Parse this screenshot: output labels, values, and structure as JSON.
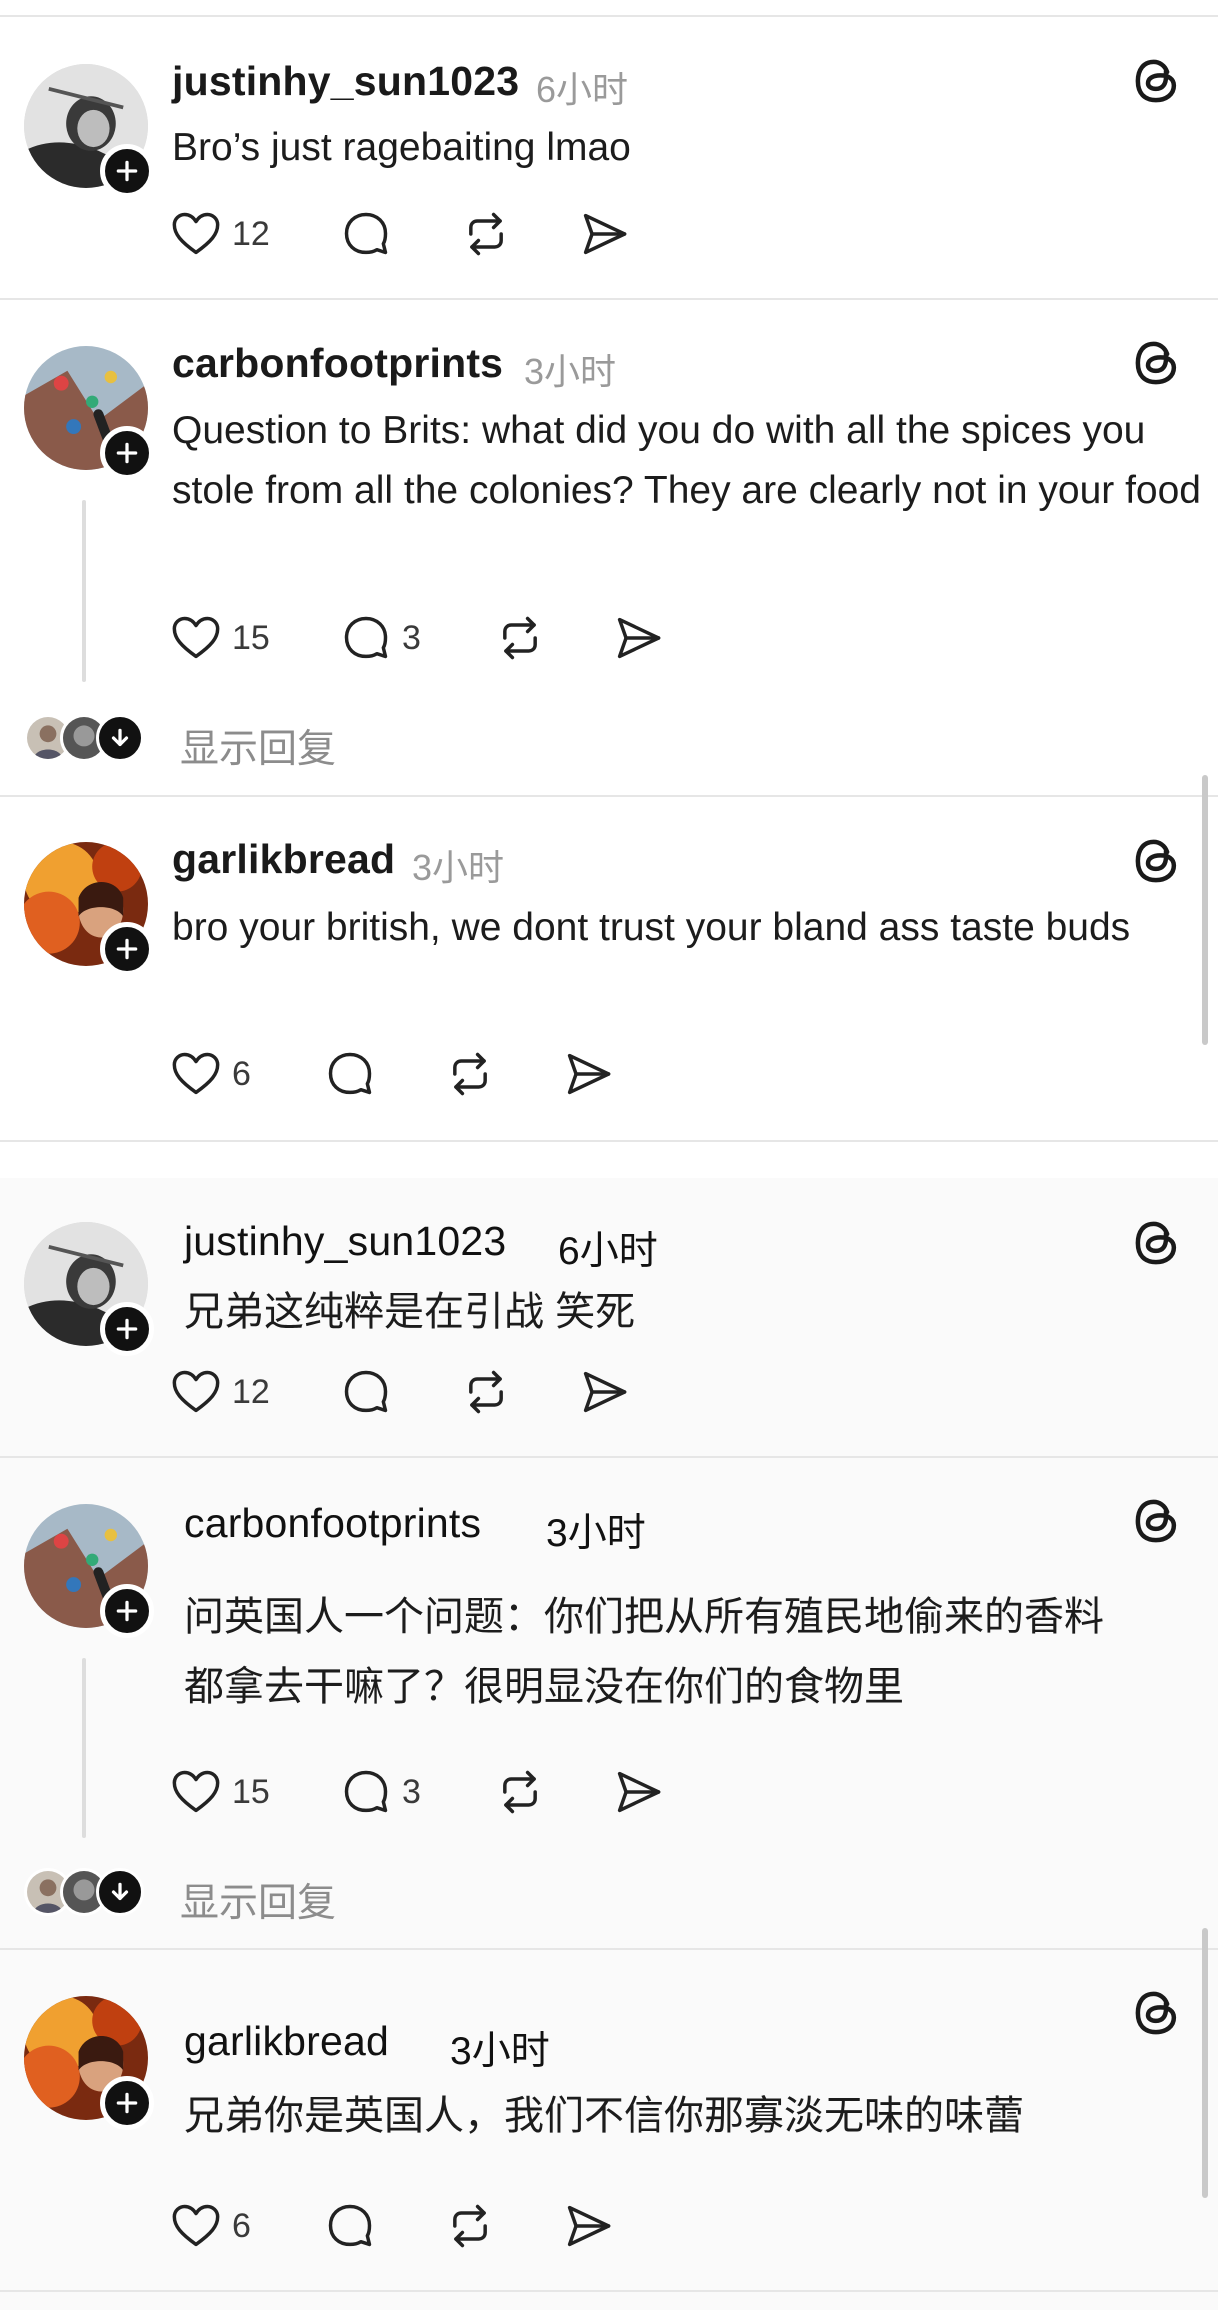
{
  "posts_en": [
    {
      "username": "justinhy_sun1023",
      "time": "6小时",
      "text": "Bro’s just ragebaiting lmao",
      "likes": "12",
      "replies": ""
    },
    {
      "username": "carbonfootprints",
      "time": "3小时",
      "text": "Question to Brits: what did you do with all the spices you stole from all the colonies? They are clearly not in your food",
      "likes": "15",
      "replies": "3",
      "show_replies": "显示回复"
    },
    {
      "username": "garlikbread",
      "time": "3小时",
      "text": "bro your british, we dont trust your bland ass taste buds",
      "likes": "6",
      "replies": ""
    }
  ],
  "posts_zh": [
    {
      "username": "justinhy_sun1023",
      "time": "6小时",
      "text": "兄弟这纯粹是在引战 笑死",
      "likes": "12",
      "replies": ""
    },
    {
      "username": "carbonfootprints",
      "time": "3小时",
      "text": "问英国人一个问题：你们把从所有殖民地偷来的香料都拿去干嘛了？很明显没在你们的食物里",
      "likes": "15",
      "replies": "3",
      "show_replies": "显示回复"
    },
    {
      "username": "garlikbread",
      "time": "3小时",
      "text": "兄弟你是英国人，我们不信你那寡淡无味的味蕾",
      "likes": "6",
      "replies": ""
    }
  ],
  "icons": {
    "like": "heart-icon",
    "reply": "comment-bubble-icon",
    "repost": "repost-icon",
    "share": "send-icon",
    "platform": "threads-logo-icon",
    "follow": "plus-icon",
    "expand": "arrow-down-icon"
  },
  "colors": {
    "text": "#1c1c1c",
    "muted": "#9a9a9a",
    "divider": "#e6e6e6",
    "follow_badge": "#111111"
  }
}
